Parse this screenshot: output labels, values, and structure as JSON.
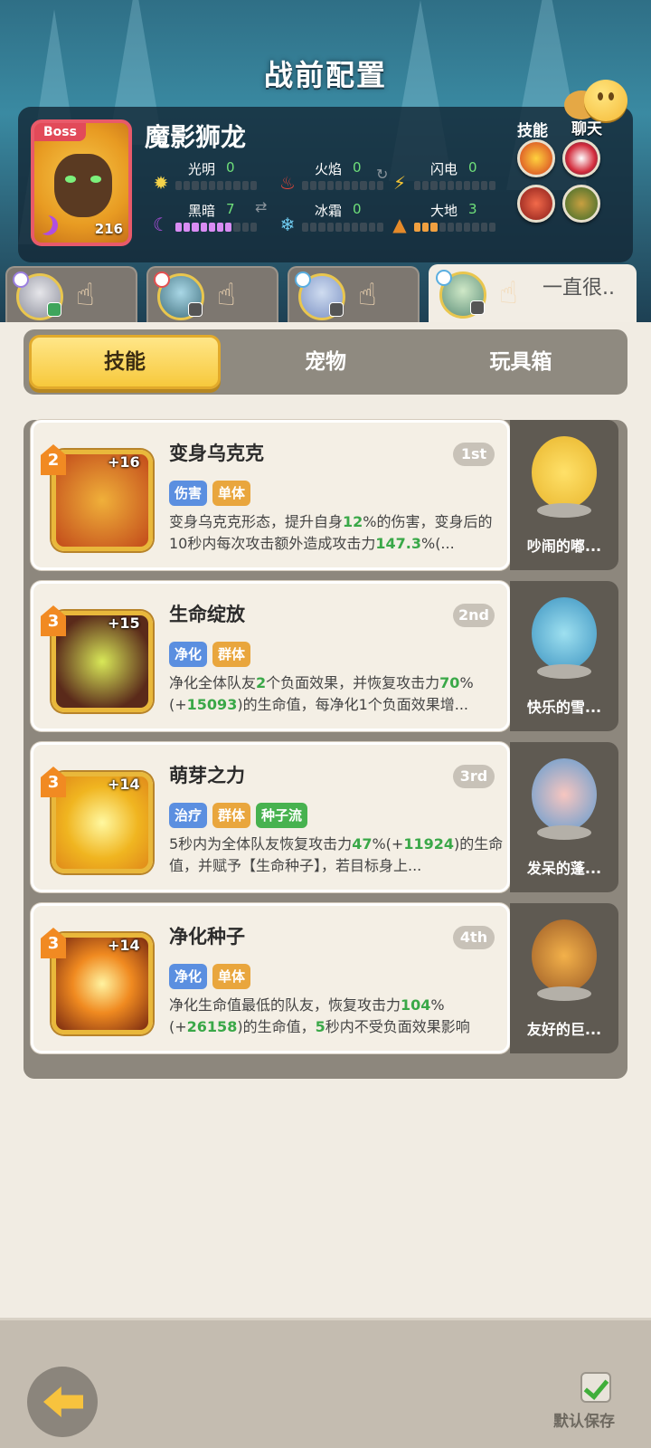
{
  "header": {
    "title": "战前配置"
  },
  "boss": {
    "tag": "Boss",
    "name": "魔影狮龙",
    "level": "216",
    "stats": [
      {
        "label": "光明",
        "value": "0",
        "fill": 0
      },
      {
        "label": "火焰",
        "value": "0",
        "fill": 0
      },
      {
        "label": "闪电",
        "value": "0",
        "fill": 0
      },
      {
        "label": "黑暗",
        "value": "7",
        "fill": 7
      },
      {
        "label": "冰霜",
        "value": "0",
        "fill": 0
      },
      {
        "label": "大地",
        "value": "3",
        "fill": 3
      }
    ],
    "skills_label": "技能"
  },
  "chat": {
    "label": "聊天"
  },
  "hero_tabs": [
    {
      "name": "hero-1",
      "text": ""
    },
    {
      "name": "hero-2",
      "text": ""
    },
    {
      "name": "hero-3",
      "text": ""
    },
    {
      "name": "hero-4",
      "text": "一直很.."
    }
  ],
  "tabs": {
    "skills": "技能",
    "pets": "宠物",
    "toybox": "玩具箱"
  },
  "cards": [
    {
      "level": "2",
      "plus": "+16",
      "title": "变身乌克克",
      "rank": "1st",
      "tags": [
        "伤害",
        "单体"
      ],
      "desc_parts": [
        "变身乌克克形态，提升自身",
        "12",
        "%的伤害，变身后的10秒内每次攻击额外造成攻击力",
        "147.3",
        "%(..."
      ],
      "pet_name": "吵闹的嘟..."
    },
    {
      "level": "3",
      "plus": "+15",
      "title": "生命绽放",
      "rank": "2nd",
      "tags": [
        "净化",
        "群体"
      ],
      "desc_parts": [
        "净化全体队友",
        "2",
        "个负面效果，并恢复攻击力",
        "70",
        "%(+",
        "15093",
        ")的生命值，每净化1个负面效果增..."
      ],
      "pet_name": "快乐的雪..."
    },
    {
      "level": "3",
      "plus": "+14",
      "title": "萌芽之力",
      "rank": "3rd",
      "tags": [
        "治疗",
        "群体",
        "种子流"
      ],
      "desc_parts": [
        "5秒内为全体队友恢复攻击力",
        "47",
        "%(+",
        "11924",
        ")的生命值，并赋予【生命种子】，若目标身上..."
      ],
      "pet_name": "发呆的蓬..."
    },
    {
      "level": "3",
      "plus": "+14",
      "title": "净化种子",
      "rank": "4th",
      "tags": [
        "净化",
        "单体"
      ],
      "desc_parts": [
        "净化生命值最低的队友，恢复攻击力",
        "104",
        "%(+",
        "26158",
        ")的生命值，",
        "5",
        "秒内不受负面效果影响"
      ],
      "pet_name": "友好的巨..."
    }
  ],
  "footer": {
    "save_label": "默认保存"
  },
  "colors": {
    "accent": "#f7c93c",
    "tag_blue": "#5b8fe0",
    "tag_orange": "#e9a63d",
    "tag_green": "#47b24f",
    "highlight": "#3aa848"
  }
}
